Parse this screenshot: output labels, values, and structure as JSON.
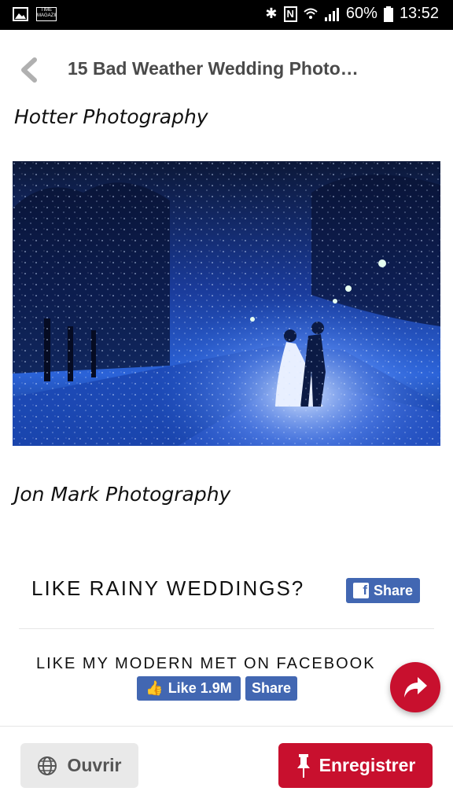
{
  "status_bar": {
    "battery_percent": "60%",
    "time": "13:52",
    "notification_icon_text": "TIME MAGAZINE"
  },
  "header": {
    "title": "15 Bad Weather Wedding Photo…"
  },
  "content": {
    "caption_top": "Hotter Photography",
    "caption_bottom": "Jon Mark Photography",
    "cta_text": "LIKE RAINY WEDDINGS?",
    "share_label": "Share",
    "follow_text": "LIKE MY MODERN MET ON FACEBOOK",
    "like_label": "Like 1.9M",
    "share2_label": "Share"
  },
  "bottom_bar": {
    "open_label": "Ouvrir",
    "save_label": "Enregistrer"
  },
  "colors": {
    "accent_red": "#c8102e",
    "facebook_blue": "#4267b2"
  }
}
